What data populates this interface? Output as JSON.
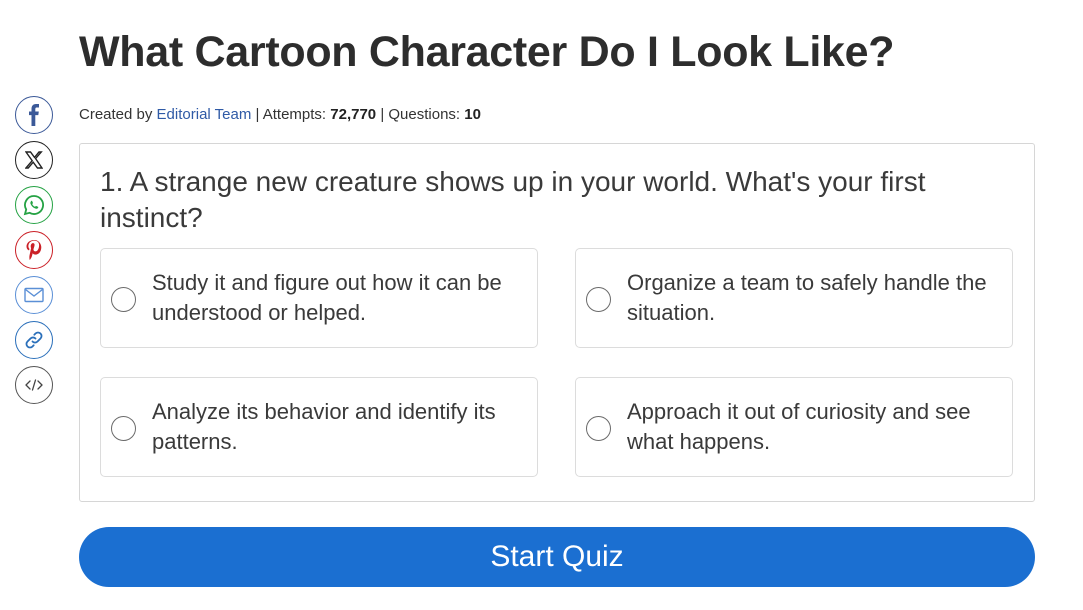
{
  "header": {
    "title": "What Cartoon Character Do I Look Like?",
    "created_by_label": "Created by ",
    "author": "Editorial Team",
    "attempts_label": " | Attempts: ",
    "attempts_value": "72,770",
    "questions_label": " | Questions: ",
    "questions_value": "10"
  },
  "share": {
    "items": [
      {
        "icon": "facebook-icon",
        "color": "#3b5998"
      },
      {
        "icon": "x-icon",
        "color": "#222222"
      },
      {
        "icon": "whatsapp-icon",
        "color": "#25a244"
      },
      {
        "icon": "pinterest-icon",
        "color": "#cb2027"
      },
      {
        "icon": "mail-icon",
        "color": "#5a8fd6"
      },
      {
        "icon": "link-icon",
        "color": "#2a6fba"
      },
      {
        "icon": "embed-icon",
        "color": "#555555"
      }
    ]
  },
  "question": {
    "text": "1. A strange new creature shows up in your world. What's your first instinct?",
    "options": [
      "Study it and figure out how it can be understood or helped.",
      "Organize a team to safely handle the situation.",
      "Analyze its behavior and identify its patterns.",
      "Approach it out of curiosity and see what happens."
    ]
  },
  "start_button": {
    "label": "Start Quiz",
    "color": "#1b6fd1"
  }
}
